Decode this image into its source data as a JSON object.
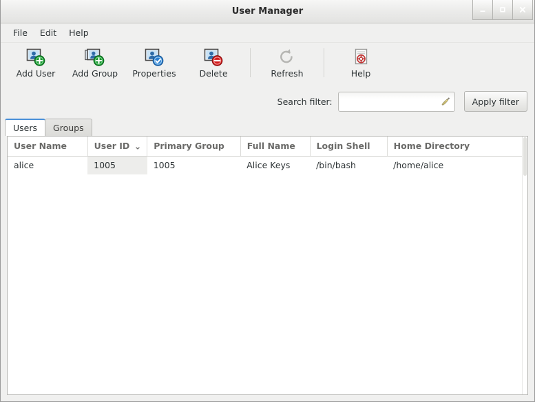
{
  "window": {
    "title": "User Manager",
    "controls": [
      {
        "name": "minimize",
        "glyph": "minimize-icon"
      },
      {
        "name": "maximize",
        "glyph": "maximize-icon"
      },
      {
        "name": "close",
        "glyph": "close-icon"
      }
    ]
  },
  "menubar": {
    "items": [
      {
        "label": "File"
      },
      {
        "label": "Edit"
      },
      {
        "label": "Help"
      }
    ]
  },
  "toolbar": {
    "buttons": [
      {
        "label": "Add User",
        "icon": "add-user-icon"
      },
      {
        "label": "Add Group",
        "icon": "add-group-icon"
      },
      {
        "label": "Properties",
        "icon": "properties-icon"
      },
      {
        "label": "Delete",
        "icon": "delete-icon"
      },
      {
        "label": "Refresh",
        "icon": "refresh-icon"
      },
      {
        "label": "Help",
        "icon": "help-icon"
      }
    ]
  },
  "filter": {
    "label": "Search filter:",
    "value": "",
    "placeholder": "",
    "clear_icon": "broom-icon",
    "apply_label": "Apply filter"
  },
  "tabs": [
    {
      "label": "Users",
      "active": true
    },
    {
      "label": "Groups",
      "active": false
    }
  ],
  "table": {
    "columns": [
      {
        "label": "User Name",
        "sorted": false
      },
      {
        "label": "User ID",
        "sorted": true,
        "sort_glyph": "⌄"
      },
      {
        "label": "Primary Group",
        "sorted": false
      },
      {
        "label": "Full Name",
        "sorted": false
      },
      {
        "label": "Login Shell",
        "sorted": false
      },
      {
        "label": "Home Directory",
        "sorted": false
      }
    ],
    "rows": [
      {
        "user_name": "alice",
        "user_id": "1005",
        "primary_group": "1005",
        "full_name": "Alice Keys",
        "login_shell": "/bin/bash",
        "home_directory": "/home/alice"
      }
    ]
  },
  "colors": {
    "accent": "#4a90d9",
    "chrome": "#f0f0ef",
    "header_text": "#6a6a68",
    "body_text": "#2e3436",
    "sorted_cell": "#ededeb"
  }
}
